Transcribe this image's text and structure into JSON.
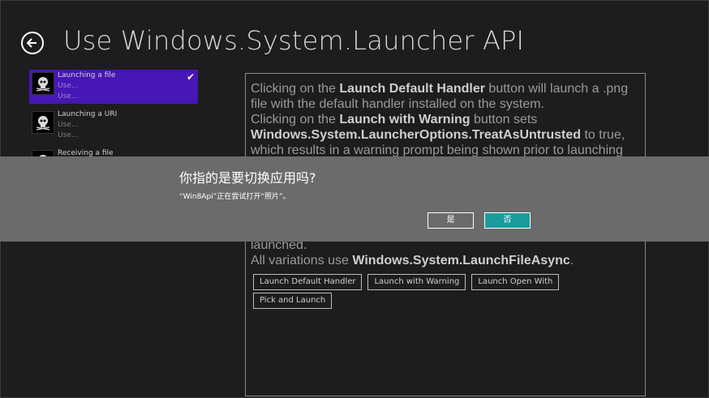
{
  "header": {
    "title": "Use Windows.System.Launcher API"
  },
  "scenarios": [
    {
      "title": "Launching a file",
      "sub1": "Use...",
      "sub2": "Use...",
      "selected": true
    },
    {
      "title": "Launching a URI",
      "sub1": "Use...",
      "sub2": "Use...",
      "selected": false
    },
    {
      "title": "Receiving a file",
      "sub1": "",
      "sub2": "",
      "selected": false
    }
  ],
  "content": {
    "p1_a": "Clicking on the ",
    "p1_b": "Launch Default Handler",
    "p1_c": " button will launch a .png file with the default handler installed on the system.",
    "p2_a": "Clicking on the ",
    "p2_b": "Launch with Warning",
    "p2_c": " button sets ",
    "p2_d": "Windows.System.LauncherOptions.TreatAsUntrusted",
    "p2_e": " to true, which results in a warning prompt being shown prior to launching",
    "p3": "launched.",
    "p4_a": "All variations use ",
    "p4_b": "Windows.System.LaunchFileAsync",
    "p4_c": ".",
    "buttons": [
      "Launch Default Handler",
      "Launch with Warning",
      "Launch Open With",
      "Pick and Launch"
    ]
  },
  "dialog": {
    "title": "你指的是要切换应用吗?",
    "message": "“Win8Api”正在尝试打开“照片”。",
    "yes_label": "是",
    "no_label": "否"
  },
  "colors": {
    "selected_bg": "#4617b4",
    "dialog_bg": "#6b6b6b",
    "accent": "#1b9b9b"
  }
}
